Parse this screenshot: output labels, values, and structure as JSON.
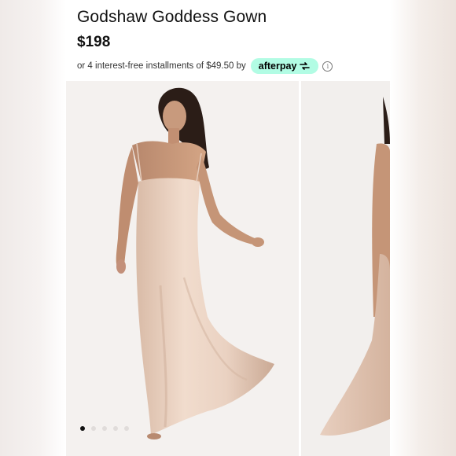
{
  "product": {
    "title": "Godshaw Goddess Gown",
    "price": "$198"
  },
  "payment": {
    "installment_text": "or 4 interest-free installments of $49.50 by",
    "provider": "afterpay",
    "badge_color": "#b2fce4",
    "info_icon": "info-icon"
  },
  "gallery": {
    "image_count": 5,
    "active_index": 0,
    "gown_color": "#ecd3c2"
  }
}
